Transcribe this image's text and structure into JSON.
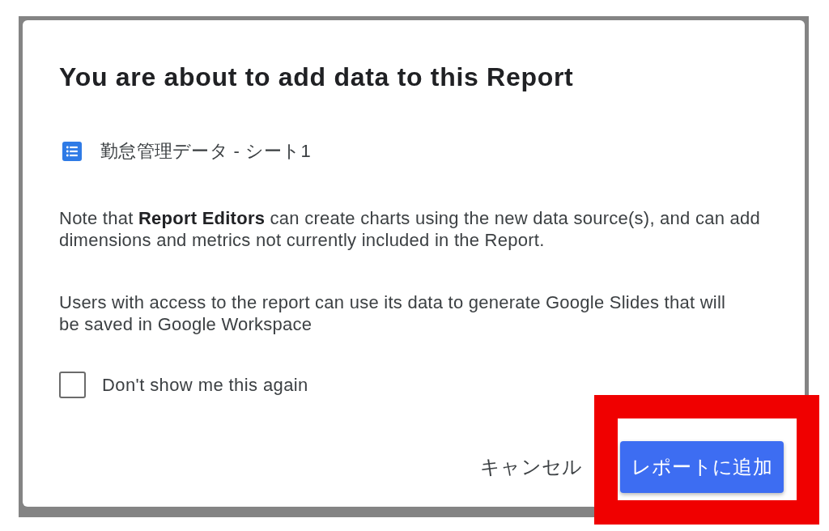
{
  "dialog": {
    "title": "You are about to add data to this Report",
    "data_source": {
      "name": "勤怠管理データ - シート1"
    },
    "notes": [
      "Note that **Report Editors** can create charts using the new data source(s), and can add dimensions and metrics not currently included in the Report.",
      "Users with access to the report can use its data to generate Google Slides that will be saved in Google Workspace"
    ],
    "checkbox": {
      "label": "Don't show me this again",
      "checked": false
    },
    "buttons": [
      {
        "label": "キャンセル",
        "kind": "text"
      },
      {
        "label": "レポートに追加",
        "kind": "primary"
      }
    ]
  }
}
